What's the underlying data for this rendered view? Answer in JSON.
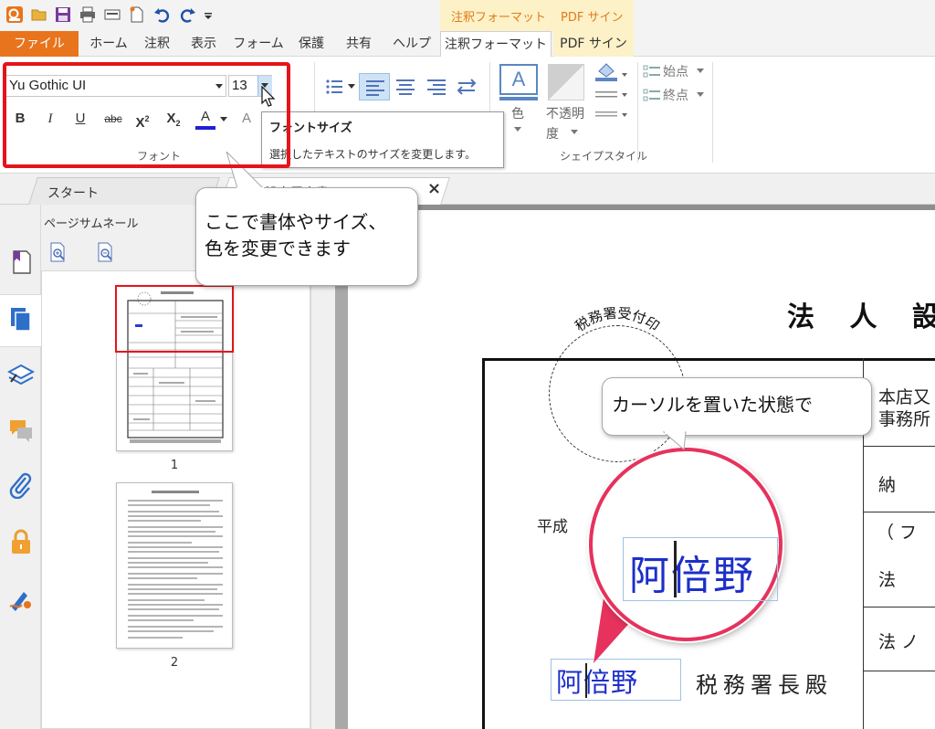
{
  "context_tabs": {
    "left": "注釈フォーマット",
    "right": "PDF サイン"
  },
  "tabs": [
    {
      "label": "ファイル"
    },
    {
      "label": "ホーム"
    },
    {
      "label": "注釈"
    },
    {
      "label": "表示"
    },
    {
      "label": "フォーム"
    },
    {
      "label": "保護"
    },
    {
      "label": "共有"
    },
    {
      "label": "ヘルプ"
    },
    {
      "label": "注釈フォーマット"
    },
    {
      "label": "PDF サイン"
    }
  ],
  "ribbon": {
    "font_name": "Yu Gothic UI",
    "font_size": "13",
    "format_buttons": {
      "bold": "B",
      "italic": "I",
      "underline": "U",
      "strike": "abc",
      "superscript": "X",
      "subscript": "X",
      "sup_mark": "2",
      "sub_mark": "2",
      "font_color": "A",
      "char_spacing": "A"
    },
    "font_group_label": "フォント",
    "color_label": "色",
    "opacity_label": "不透明度",
    "opacity_label_1": "不透明",
    "opacity_label_2": "度",
    "shape_style_label": "シェイプスタイル",
    "start_point_label": "始点",
    "end_point_label": "終点",
    "color_swatch_text": "A"
  },
  "tooltip": {
    "title": "フォントサイズ",
    "description": "選択したテキストのサイズを変更します。"
  },
  "callout_top": {
    "line1": "ここで書体やサイズ、",
    "line2": "色を変更できます"
  },
  "doc_tabs": {
    "start": "スタート",
    "document_fragment": "法人設立届出書.pdf",
    "close": "×"
  },
  "thumbnails": {
    "panel_title": "ページサムネール",
    "pages": [
      {
        "number": "1"
      },
      {
        "number": "2"
      }
    ]
  },
  "document": {
    "title": "法 人 設",
    "stamp_label": "税務署受付印",
    "heisei": "平成",
    "name_value": "阿倍野",
    "tax_office": "税務署長殿",
    "cells": {
      "honten": "本店又",
      "jimusho": "事務所",
      "nou": "納",
      "furi": "（ フ",
      "hou": "法",
      "hou2": "法 ノ"
    }
  },
  "callout_cursor": {
    "text": "カーソルを置いた状態で"
  },
  "magnifier": {
    "name_value": "阿倍野"
  },
  "colors": {
    "accent_orange": "#e8741d",
    "context_tab_bg": "#fdf1c8",
    "highlight_red": "#e5141b",
    "callout_pink": "#e6325d",
    "font_color_bar": "#1f1fd6",
    "name_blue": "#1d2fc8"
  },
  "icons": [
    "app-logo-icon",
    "open-folder-icon",
    "save-icon",
    "print-icon",
    "scan-icon",
    "new-doc-icon",
    "undo-icon",
    "redo-icon",
    "customize-qat-icon",
    "bullet-list-icon",
    "align-left-icon",
    "align-center-icon",
    "align-right-icon",
    "text-direction-icon",
    "bookmark-icon",
    "pages-icon",
    "layers-icon",
    "comments-icon",
    "attachment-icon",
    "lock-icon",
    "signature-icon",
    "zoom-in-page-icon",
    "zoom-out-page-icon",
    "mouse-cursor-icon"
  ]
}
